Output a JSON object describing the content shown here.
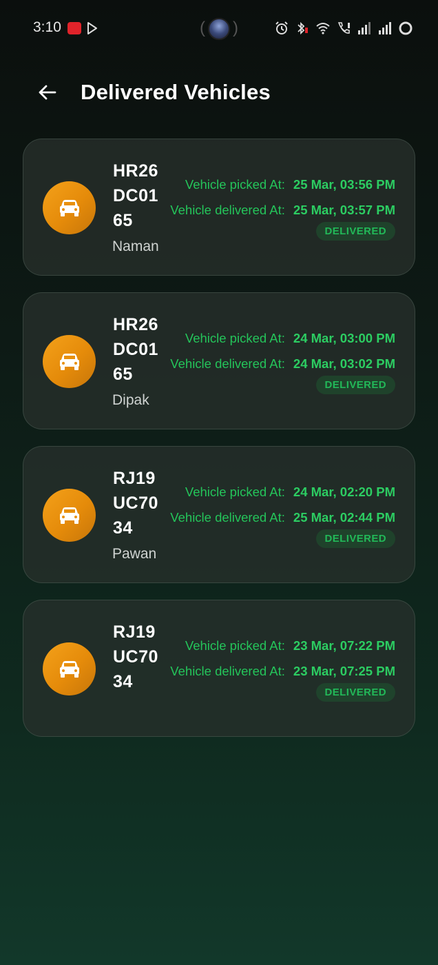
{
  "status_bar": {
    "time": "3:10"
  },
  "header": {
    "title": "Delivered Vehicles"
  },
  "labels": {
    "picked": "Vehicle picked At:",
    "delivered": "Vehicle delivered At:"
  },
  "colors": {
    "accent_green": "#2ccd62",
    "car_icon_orange": "#f4a11a",
    "status_red": "#e0232a"
  },
  "deliveries": [
    {
      "plate": "HR26DC0165",
      "driver": "Naman",
      "picked_at": "25 Mar, 03:56 PM",
      "delivered_at": "25 Mar, 03:57 PM",
      "status": "DELIVERED"
    },
    {
      "plate": "HR26DC0165",
      "driver": "Dipak",
      "picked_at": "24 Mar, 03:00 PM",
      "delivered_at": "24 Mar, 03:02 PM",
      "status": "DELIVERED"
    },
    {
      "plate": "RJ19UC7034",
      "driver": "Pawan",
      "picked_at": "24 Mar, 02:20 PM",
      "delivered_at": "25 Mar, 02:44 PM",
      "status": "DELIVERED"
    },
    {
      "plate": "RJ19UC7034",
      "driver": "",
      "picked_at": "23 Mar, 07:22 PM",
      "delivered_at": "23 Mar, 07:25 PM",
      "status": "DELIVERED"
    }
  ]
}
